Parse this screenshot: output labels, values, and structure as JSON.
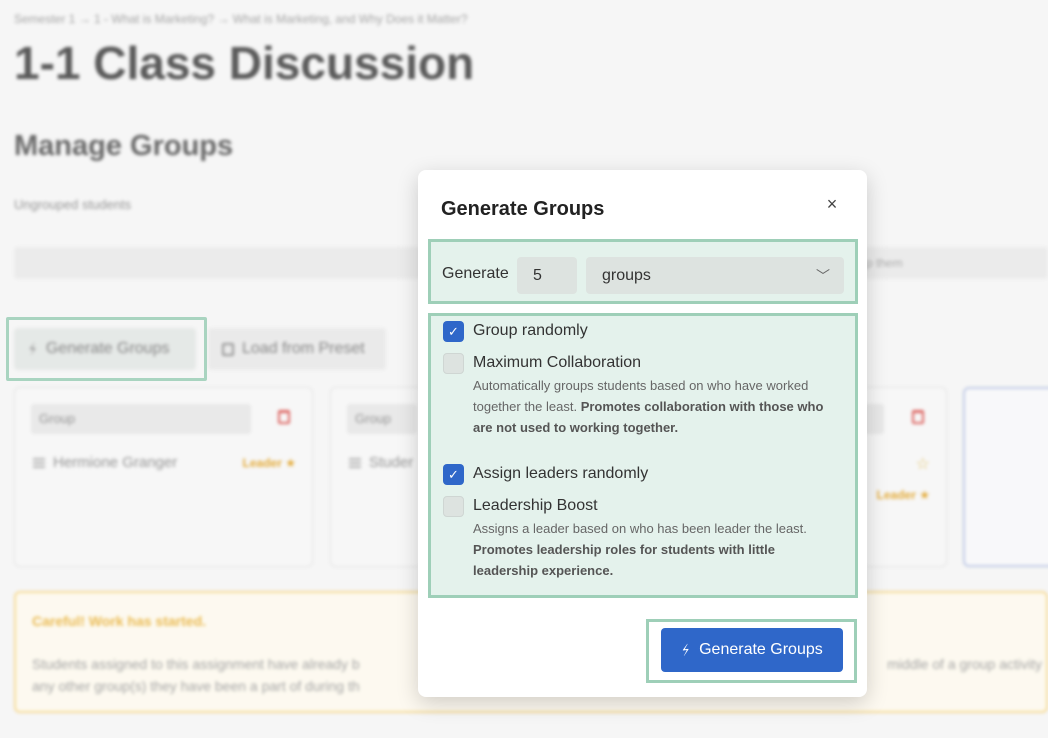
{
  "breadcrumb": "Semester 1 → 1 - What is Marketing? → What is Marketing, and Why Does it Matter?",
  "page_title": "1-1 Class Discussion",
  "section_title": "Manage Groups",
  "ungrouped_label": "Ungrouped students",
  "drop_hint": "p them",
  "toolbar": {
    "generate_groups": "Generate Groups",
    "load_preset": "Load from Preset"
  },
  "groups": [
    {
      "name_placeholder": "Group",
      "member": "Hermione Granger",
      "leader_label": "Leader ★"
    },
    {
      "name_placeholder": "Group",
      "member": "Studer"
    }
  ],
  "group3": {
    "leader_label": "Leader ★",
    "star": "☆"
  },
  "warning": {
    "title": "Careful! Work has started.",
    "text_left": "Students assigned to this assignment have already b",
    "text_left2": "any other group(s) they have been a part of during th",
    "text_right": "middle of a group activity"
  },
  "modal": {
    "title": "Generate Groups",
    "close": "×",
    "generate_label": "Generate",
    "count_value": "5",
    "unit_value": "groups",
    "options": [
      {
        "label": "Group randomly",
        "checked": true
      },
      {
        "label": "Maximum Collaboration",
        "checked": false,
        "desc": "Automatically groups students based on who have worked together the least.",
        "desc_bold": "Promotes collaboration with those who are not used to working together."
      },
      {
        "label": "Assign leaders randomly",
        "checked": true
      },
      {
        "label": "Leadership Boost",
        "checked": false,
        "desc": "Assigns a leader based on who has been leader the least.",
        "desc_bold": "Promotes leadership roles for students with little leadership experience."
      }
    ],
    "primary_button": "Generate Groups"
  },
  "colors": {
    "primary": "#2f67c9",
    "highlight_border": "#9ecfb8",
    "highlight_fill": "#e4f2ec",
    "warning": "#e8b23c"
  },
  "icons": {
    "wand": "magic-wand-icon",
    "save": "save-icon",
    "trash": "trash-icon",
    "drag": "drag-handle-icon",
    "close": "close-icon",
    "chevron": "chevron-down-icon",
    "check": "check-icon"
  }
}
